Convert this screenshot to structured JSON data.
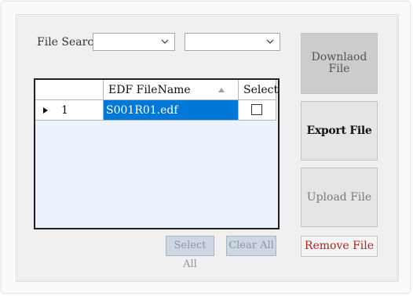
{
  "search": {
    "label": "File Search",
    "combo1_value": "",
    "combo2_value": ""
  },
  "grid": {
    "columns": [
      "",
      "EDF FileName",
      "Select"
    ],
    "rows": [
      {
        "index": "1",
        "file_name": "S001R01.edf",
        "selected": false
      }
    ]
  },
  "buttons": {
    "download": "Downlaod\nFile",
    "export": "Export File",
    "upload": "Upload File",
    "remove": "Remove File",
    "select_all": "Select All",
    "clear_all": "Clear All"
  },
  "colors": {
    "selection": "#0078d7",
    "remove_text": "#b22222",
    "grid_background": "#eaf3fb"
  },
  "icons": {
    "combo": "chevron-down-icon",
    "sort": "sort-ascending-icon",
    "row": "row-pointer-icon"
  }
}
